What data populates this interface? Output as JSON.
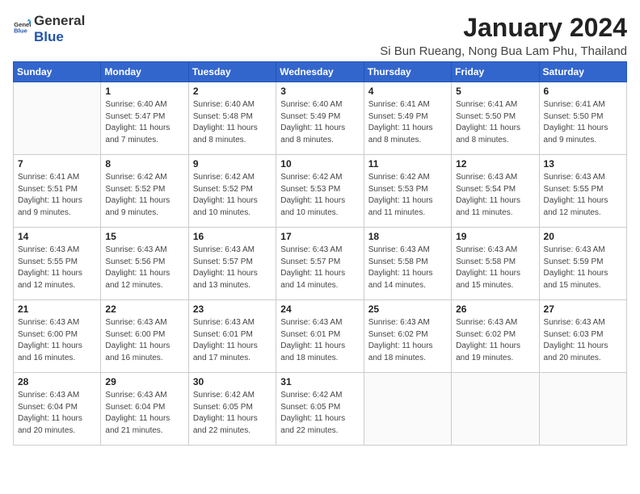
{
  "logo": {
    "general": "General",
    "blue": "Blue"
  },
  "title": "January 2024",
  "subtitle": "Si Bun Rueang, Nong Bua Lam Phu, Thailand",
  "headers": [
    "Sunday",
    "Monday",
    "Tuesday",
    "Wednesday",
    "Thursday",
    "Friday",
    "Saturday"
  ],
  "weeks": [
    [
      {
        "day": "",
        "info": ""
      },
      {
        "day": "1",
        "info": "Sunrise: 6:40 AM\nSunset: 5:47 PM\nDaylight: 11 hours\nand 7 minutes."
      },
      {
        "day": "2",
        "info": "Sunrise: 6:40 AM\nSunset: 5:48 PM\nDaylight: 11 hours\nand 8 minutes."
      },
      {
        "day": "3",
        "info": "Sunrise: 6:40 AM\nSunset: 5:49 PM\nDaylight: 11 hours\nand 8 minutes."
      },
      {
        "day": "4",
        "info": "Sunrise: 6:41 AM\nSunset: 5:49 PM\nDaylight: 11 hours\nand 8 minutes."
      },
      {
        "day": "5",
        "info": "Sunrise: 6:41 AM\nSunset: 5:50 PM\nDaylight: 11 hours\nand 8 minutes."
      },
      {
        "day": "6",
        "info": "Sunrise: 6:41 AM\nSunset: 5:50 PM\nDaylight: 11 hours\nand 9 minutes."
      }
    ],
    [
      {
        "day": "7",
        "info": "Sunrise: 6:41 AM\nSunset: 5:51 PM\nDaylight: 11 hours\nand 9 minutes."
      },
      {
        "day": "8",
        "info": "Sunrise: 6:42 AM\nSunset: 5:52 PM\nDaylight: 11 hours\nand 9 minutes."
      },
      {
        "day": "9",
        "info": "Sunrise: 6:42 AM\nSunset: 5:52 PM\nDaylight: 11 hours\nand 10 minutes."
      },
      {
        "day": "10",
        "info": "Sunrise: 6:42 AM\nSunset: 5:53 PM\nDaylight: 11 hours\nand 10 minutes."
      },
      {
        "day": "11",
        "info": "Sunrise: 6:42 AM\nSunset: 5:53 PM\nDaylight: 11 hours\nand 11 minutes."
      },
      {
        "day": "12",
        "info": "Sunrise: 6:43 AM\nSunset: 5:54 PM\nDaylight: 11 hours\nand 11 minutes."
      },
      {
        "day": "13",
        "info": "Sunrise: 6:43 AM\nSunset: 5:55 PM\nDaylight: 11 hours\nand 12 minutes."
      }
    ],
    [
      {
        "day": "14",
        "info": "Sunrise: 6:43 AM\nSunset: 5:55 PM\nDaylight: 11 hours\nand 12 minutes."
      },
      {
        "day": "15",
        "info": "Sunrise: 6:43 AM\nSunset: 5:56 PM\nDaylight: 11 hours\nand 12 minutes."
      },
      {
        "day": "16",
        "info": "Sunrise: 6:43 AM\nSunset: 5:57 PM\nDaylight: 11 hours\nand 13 minutes."
      },
      {
        "day": "17",
        "info": "Sunrise: 6:43 AM\nSunset: 5:57 PM\nDaylight: 11 hours\nand 14 minutes."
      },
      {
        "day": "18",
        "info": "Sunrise: 6:43 AM\nSunset: 5:58 PM\nDaylight: 11 hours\nand 14 minutes."
      },
      {
        "day": "19",
        "info": "Sunrise: 6:43 AM\nSunset: 5:58 PM\nDaylight: 11 hours\nand 15 minutes."
      },
      {
        "day": "20",
        "info": "Sunrise: 6:43 AM\nSunset: 5:59 PM\nDaylight: 11 hours\nand 15 minutes."
      }
    ],
    [
      {
        "day": "21",
        "info": "Sunrise: 6:43 AM\nSunset: 6:00 PM\nDaylight: 11 hours\nand 16 minutes."
      },
      {
        "day": "22",
        "info": "Sunrise: 6:43 AM\nSunset: 6:00 PM\nDaylight: 11 hours\nand 16 minutes."
      },
      {
        "day": "23",
        "info": "Sunrise: 6:43 AM\nSunset: 6:01 PM\nDaylight: 11 hours\nand 17 minutes."
      },
      {
        "day": "24",
        "info": "Sunrise: 6:43 AM\nSunset: 6:01 PM\nDaylight: 11 hours\nand 18 minutes."
      },
      {
        "day": "25",
        "info": "Sunrise: 6:43 AM\nSunset: 6:02 PM\nDaylight: 11 hours\nand 18 minutes."
      },
      {
        "day": "26",
        "info": "Sunrise: 6:43 AM\nSunset: 6:02 PM\nDaylight: 11 hours\nand 19 minutes."
      },
      {
        "day": "27",
        "info": "Sunrise: 6:43 AM\nSunset: 6:03 PM\nDaylight: 11 hours\nand 20 minutes."
      }
    ],
    [
      {
        "day": "28",
        "info": "Sunrise: 6:43 AM\nSunset: 6:04 PM\nDaylight: 11 hours\nand 20 minutes."
      },
      {
        "day": "29",
        "info": "Sunrise: 6:43 AM\nSunset: 6:04 PM\nDaylight: 11 hours\nand 21 minutes."
      },
      {
        "day": "30",
        "info": "Sunrise: 6:42 AM\nSunset: 6:05 PM\nDaylight: 11 hours\nand 22 minutes."
      },
      {
        "day": "31",
        "info": "Sunrise: 6:42 AM\nSunset: 6:05 PM\nDaylight: 11 hours\nand 22 minutes."
      },
      {
        "day": "",
        "info": ""
      },
      {
        "day": "",
        "info": ""
      },
      {
        "day": "",
        "info": ""
      }
    ]
  ]
}
